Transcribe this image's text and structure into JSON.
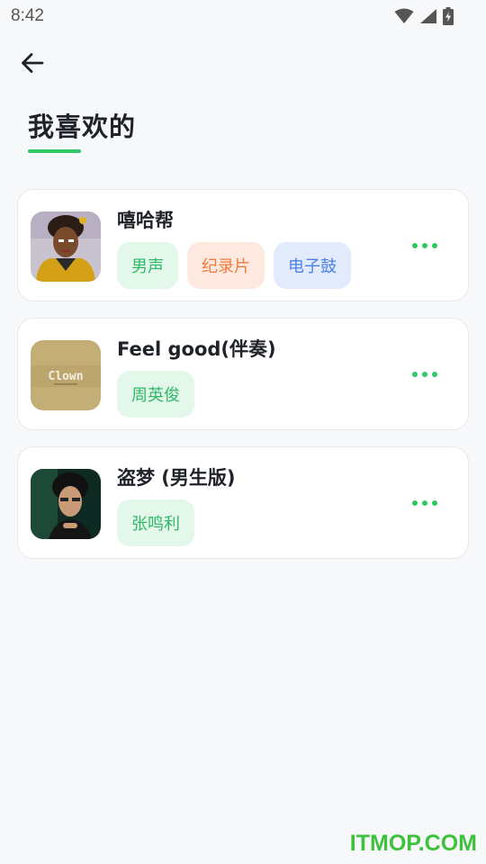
{
  "status_bar": {
    "time": "8:42",
    "icons": [
      "wifi-icon",
      "cellular-icon",
      "battery-charging-icon"
    ]
  },
  "header": {
    "back_icon": "arrow-left-icon",
    "title": "我喜欢的",
    "accent_color": "#2ec866"
  },
  "songs": [
    {
      "title": "嘻哈帮",
      "cover": "cartoon-hiphop-girl-cover",
      "tags": [
        {
          "label": "男声",
          "color": "green"
        },
        {
          "label": "纪录片",
          "color": "orange"
        },
        {
          "label": "电子鼓",
          "color": "blue"
        }
      ]
    },
    {
      "title": "Feel good(伴奏)",
      "cover": "clown-album-cover",
      "cover_text": "Clown",
      "tags": [
        {
          "label": "周英俊",
          "color": "green"
        }
      ]
    },
    {
      "title": "盗梦 (男生版)",
      "cover": "portrait-man-cover",
      "tags": [
        {
          "label": "张鸣利",
          "color": "green"
        }
      ]
    }
  ],
  "more_icon": "more-dots-icon",
  "watermark": "ITMOP.COM"
}
